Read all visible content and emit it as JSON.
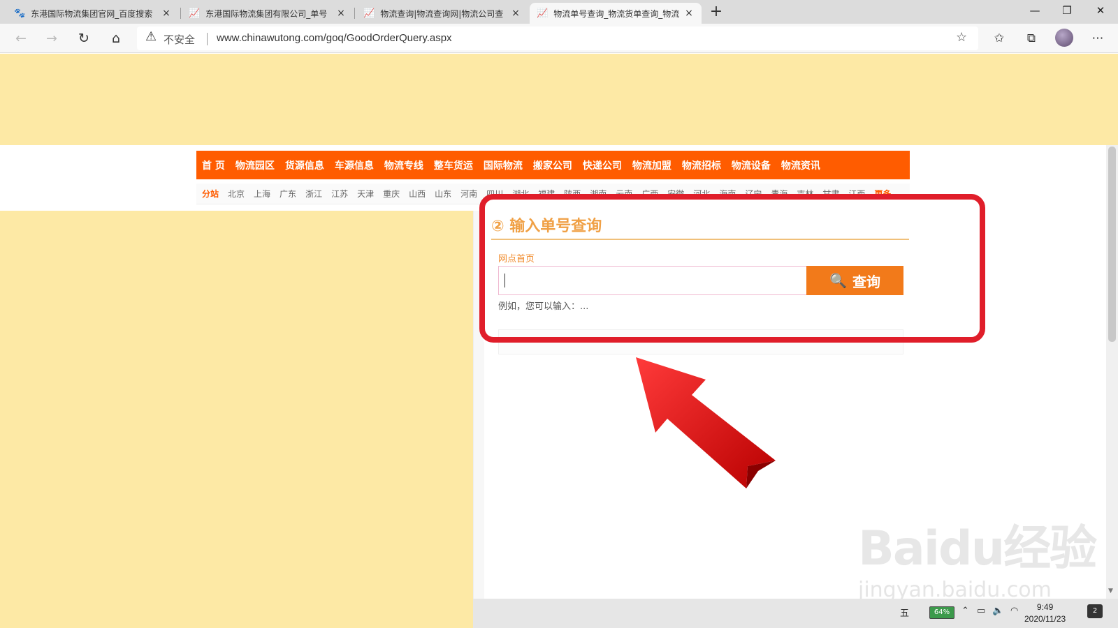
{
  "browser": {
    "tabs": [
      {
        "label": "东港国际物流集团官网_百度搜索"
      },
      {
        "label": "东港国际物流集团有限公司_单号"
      },
      {
        "label": "物流查询|物流查询网|物流公司查"
      },
      {
        "label": "物流单号查询_物流货单查询_物流"
      }
    ],
    "new_tab": "+",
    "controls": {
      "minimize": "—",
      "restore": "❐",
      "close": "✕"
    },
    "security_label": "不安全",
    "url": "www.chinawutong.com/goq/GoodOrderQuery.aspx"
  },
  "site": {
    "nav_items": [
      "首 页",
      "物流园区",
      "货源信息",
      "车源信息",
      "物流专线",
      "整车货运",
      "国际物流",
      "搬家公司",
      "快递公司",
      "物流加盟",
      "物流招标",
      "物流设备",
      "物流资讯"
    ],
    "substations_label": "分站",
    "substations": [
      "北京",
      "上海",
      "广东",
      "浙江",
      "江苏",
      "天津",
      "重庆",
      "山西",
      "山东",
      "河南",
      "四川",
      "湖北",
      "福建",
      "陕西",
      "湖南",
      "云南",
      "广西",
      "安徽",
      "河北",
      "海南",
      "辽宁",
      "青海",
      "吉林",
      "甘肃",
      "江西"
    ],
    "substations_more": "更多"
  },
  "query": {
    "title": "② 输入单号查询",
    "link": "网点首页",
    "input_value": "",
    "button_label": "查询",
    "example": "例如，您可以输入：..."
  },
  "taskbar": {
    "ime": "五",
    "battery": "64%",
    "time": "9:49",
    "date": "2020/11/23",
    "notifications": "2"
  },
  "watermark": {
    "brand": "Baidu经验",
    "domain": "jingyan.baidu.com"
  },
  "colors": {
    "nav": "#ff5c00",
    "ad": "#fde9a5",
    "highlight": "#e01e2a",
    "button": "#f27a1a"
  }
}
